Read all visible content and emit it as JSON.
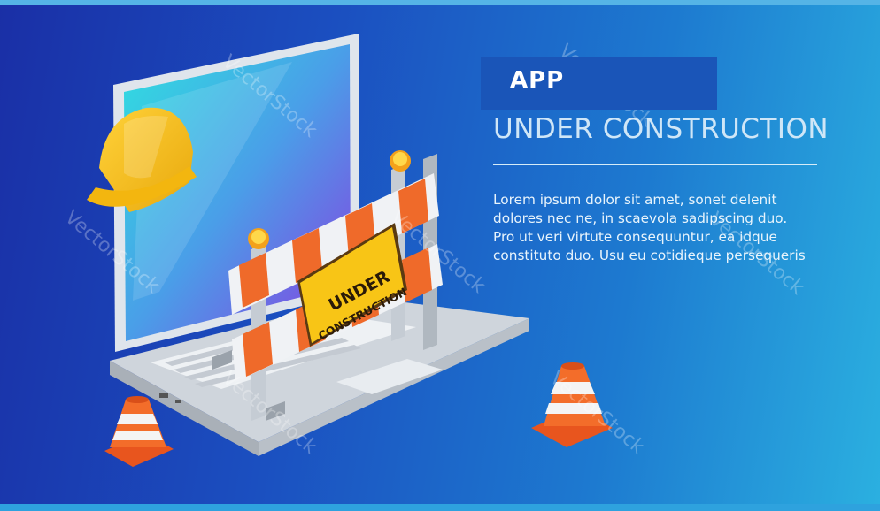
{
  "banner": {
    "app_label": "APP",
    "headline": "UNDER CONSTRUCTION",
    "body_lines": [
      "Lorem ipsum dolor sit amet, sonet delenit",
      "dolores nec ne, in scaevola sadipscing duo.",
      "Pro ut veri virtute consequuntur, ea idque",
      "constituto duo. Usu eu cotidieque persequeris"
    ],
    "sign_line1": "UNDER",
    "sign_line2": "CONSTRUCTION",
    "watermark": "VectorStock"
  },
  "colors": {
    "background_start": "#1a2fa6",
    "background_end": "#2bb0e0",
    "helmet": "#f6c21c",
    "barrier_orange": "#ef6a2a",
    "sign_yellow": "#f8c516"
  },
  "icons": [
    "laptop-icon",
    "hard-hat-icon",
    "barrier-icon",
    "traffic-cone-icon"
  ]
}
